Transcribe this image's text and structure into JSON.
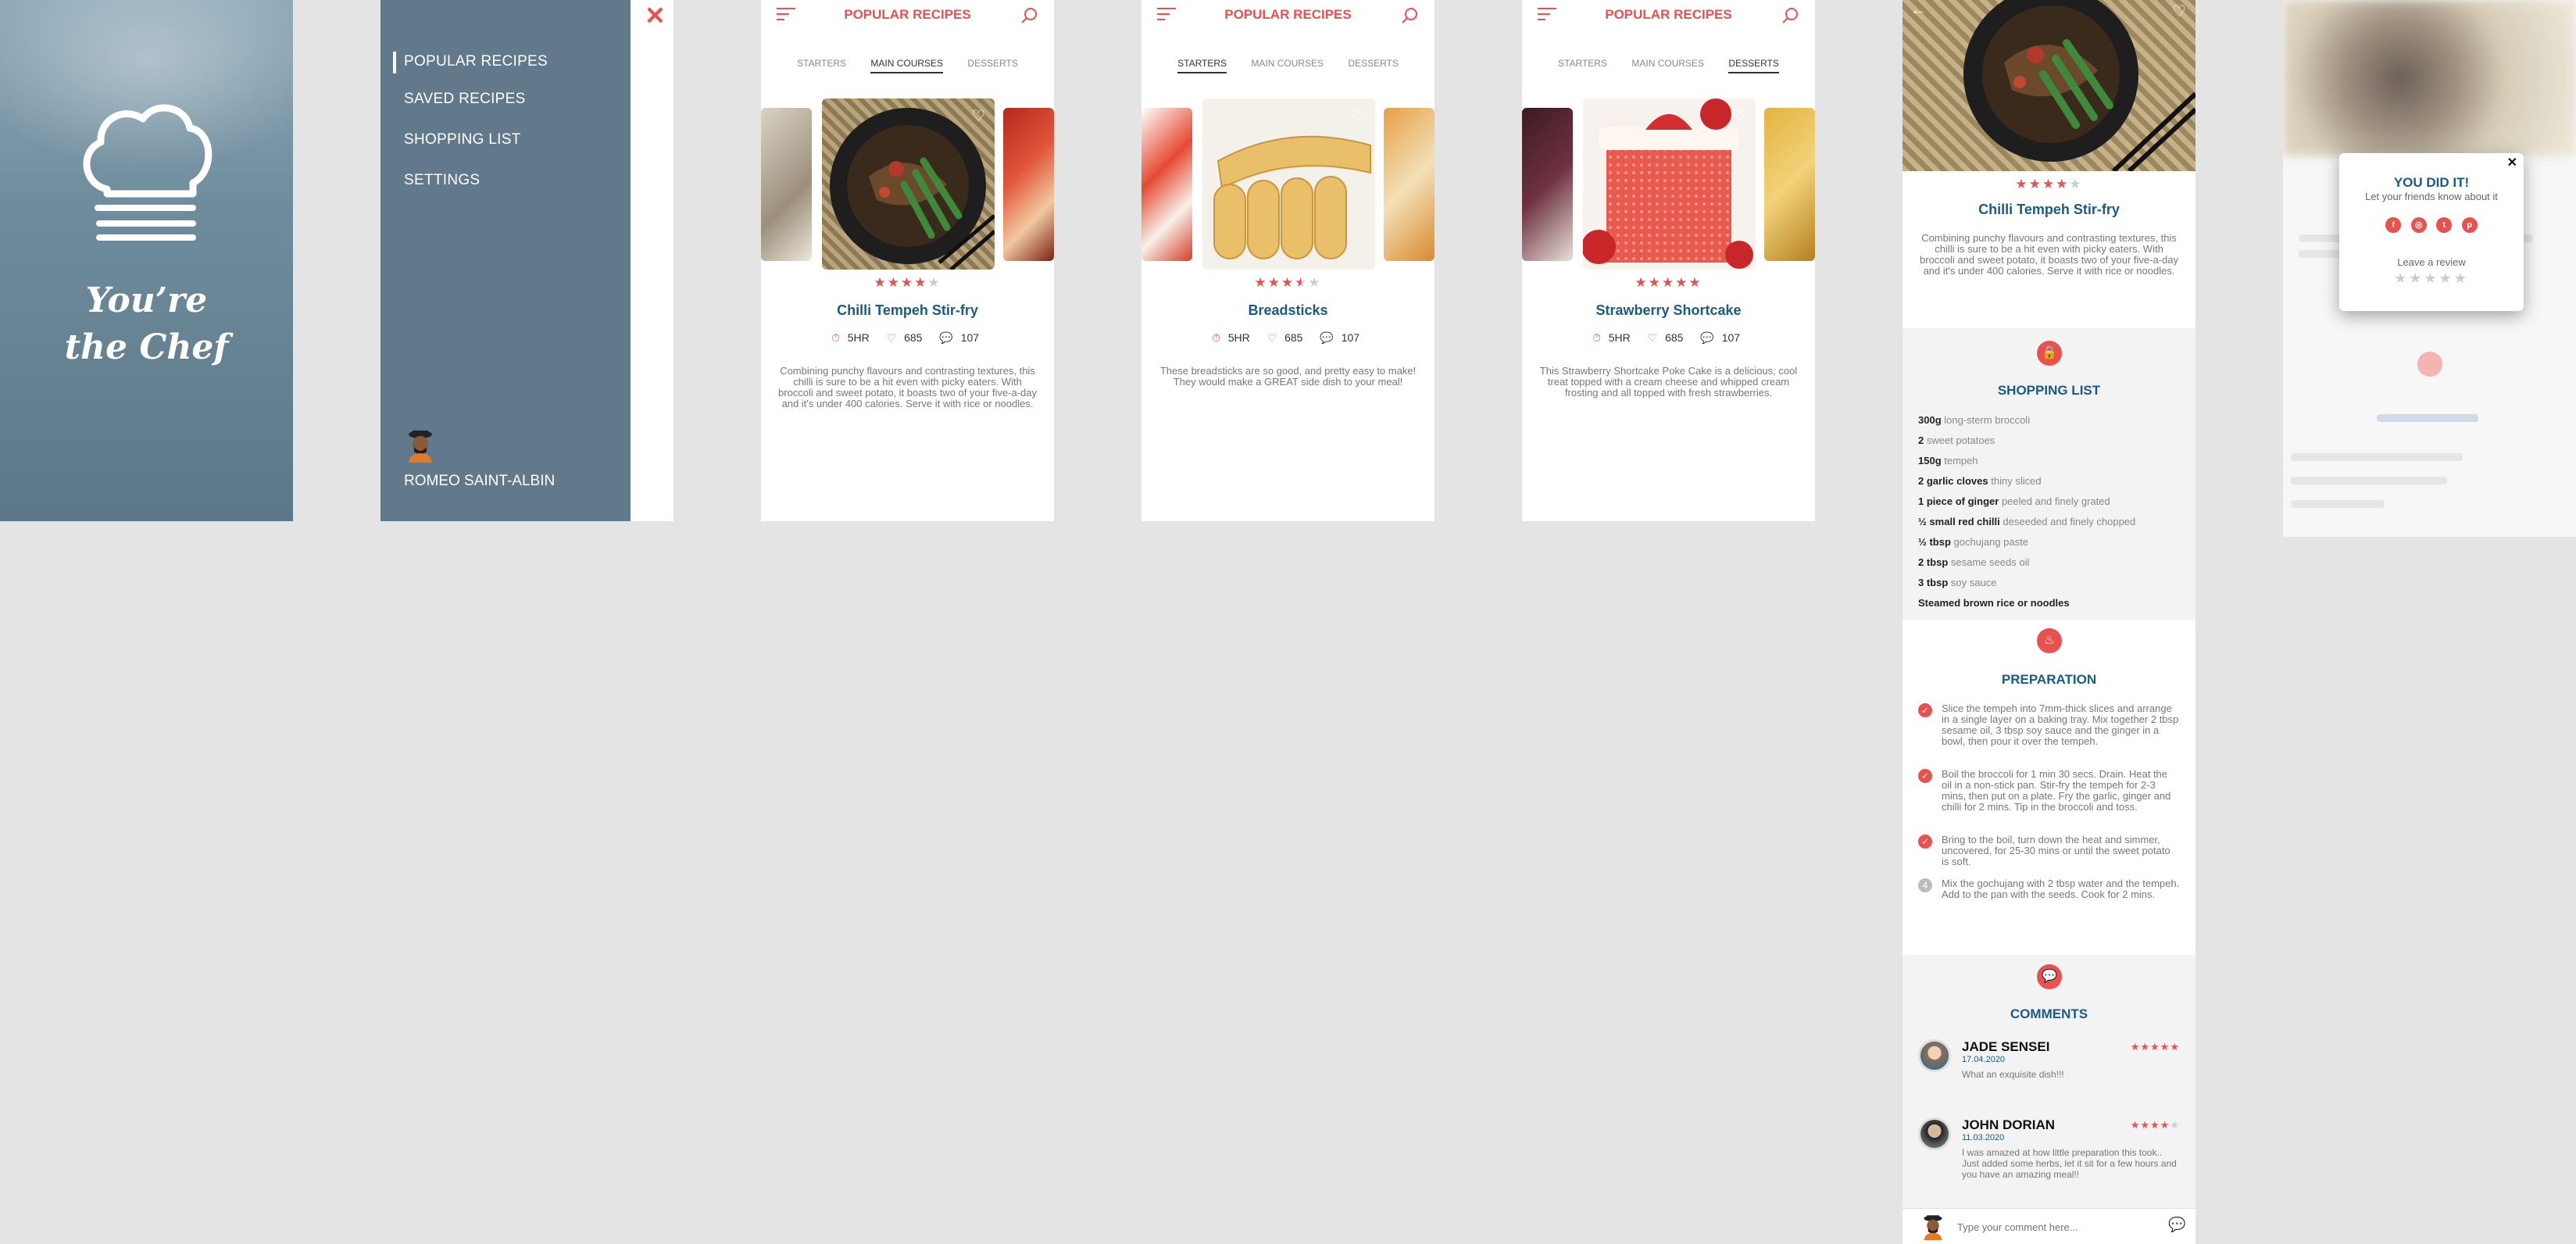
{
  "splash": {
    "tagline_line1": "You’re",
    "tagline_line2": "the Chef"
  },
  "menu": {
    "items": [
      "POPULAR RECIPES",
      "SAVED RECIPES",
      "SHOPPING LIST",
      "SETTINGS"
    ],
    "user_name": "ROMEO SAINT-ALBIN"
  },
  "screens": [
    {
      "title": "POPULAR RECIPES",
      "tabs": [
        "STARTERS",
        "MAIN COURSES",
        "DESSERTS"
      ],
      "active_tab": 1,
      "rating": 4,
      "recipe_name": "Chilli Tempeh Stir-fry",
      "time": "5HR",
      "likes": "685",
      "comments": "107",
      "description": "Combining punchy flavours and contrasting textures, this chilli is sure to be a hit even with picky eaters. With broccoli and sweet potato, it boasts two of your five-a-day and it's under 400 calories. Serve it with rice or noodles."
    },
    {
      "title": "POPULAR RECIPES",
      "tabs": [
        "STARTERS",
        "MAIN COURSES",
        "DESSERTS"
      ],
      "active_tab": 0,
      "rating": 3.5,
      "recipe_name": "Breadsticks",
      "time": "5HR",
      "likes": "685",
      "comments": "107",
      "description": "These breadsticks are so good, and pretty easy to make!  They would make a GREAT side dish to your meal!"
    },
    {
      "title": "POPULAR RECIPES",
      "tabs": [
        "STARTERS",
        "MAIN COURSES",
        "DESSERTS"
      ],
      "active_tab": 2,
      "rating": 5,
      "recipe_name": "Strawberry Shortcake",
      "time": "5HR",
      "likes": "685",
      "comments": "107",
      "description": "This Strawberry Shortcake Poke Cake is a delicious, cool treat topped with a cream cheese and whipped cream frosting and all topped with fresh strawberries."
    }
  ],
  "detail": {
    "rating": 4,
    "title": "Chilli Tempeh Stir-fry",
    "description": "Combining punchy flavours and contrasting textures, this chilli is sure to be a hit even with picky eaters. With broccoli and sweet potato, it boasts two of your five-a-day and it's under 400 calories. Serve it with rice or noodles.",
    "shopping_title": "SHOPPING LIST",
    "ingredients": [
      {
        "qty": "300g",
        "item": "long-sterm broccoli"
      },
      {
        "qty": "2",
        "item": "sweet potatoes"
      },
      {
        "qty": "150g",
        "item": "tempeh"
      },
      {
        "qty": "2 garlic cloves",
        "item": "thiny sliced"
      },
      {
        "qty": "1 piece of ginger",
        "item": "peeled and finely grated"
      },
      {
        "qty": "½ small red chilli",
        "item": "deseeded and finely chopped"
      },
      {
        "qty": "½ tbsp",
        "item": "gochujang paste"
      },
      {
        "qty": "2 tbsp",
        "item": "sesame seeds oil"
      },
      {
        "qty": "3 tbsp",
        "item": "soy sauce"
      },
      {
        "qty": "Steamed brown rice or noodles",
        "item": ""
      }
    ],
    "preparation_title": "PREPARATION",
    "steps": [
      {
        "text": "Slice the tempeh into 7mm-thick slices and arrange in a single layer on a baking tray. Mix together 2 tbsp sesame oil, 3 tbsp soy sauce and the ginger in a bowl, then pour it over the tempeh.",
        "done": true
      },
      {
        "text": "Boil the broccoli for 1 min 30 secs. Drain. Heat the oil in a non-stick pan. Stir-fry the tempeh for 2-3 mins, then put on a plate. Fry the garlic, ginger and chilli for 2 mins. Tip in the broccoli and toss.",
        "done": true
      },
      {
        "text": "Bring to the boil, turn down the heat and simmer, uncovered, for 25-30 mins or until the sweet potato is soft.",
        "done": true
      },
      {
        "text": "Mix the gochujang with 2 tbsp water and the tempeh. Add to the pan with the seeds. Cook for 2 mins.",
        "done": false,
        "num": "4"
      }
    ],
    "comments_title": "COMMENTS",
    "comments": [
      {
        "name": "JADE SENSEI",
        "date": "17.04.2020",
        "rating": 5,
        "text": "What an exquisite dish!!!"
      },
      {
        "name": "JOHN DORIAN",
        "date": "11.03.2020",
        "rating": 4,
        "text": "I was amazed at how little preparation this took.. Just added some herbs, let it sit for a few hours and you have an amazing meal!!"
      }
    ],
    "comment_placeholder": "Type your comment here..."
  },
  "popup": {
    "title": "YOU DID IT!",
    "subtitle": "Let your friends know about it",
    "social": [
      "f",
      "ig",
      "tw",
      "p"
    ],
    "leave_review": "Leave a review"
  },
  "colors": {
    "accent": "#e8514e",
    "title_blue": "#1b5a86",
    "menu_bg": "#61798a",
    "bg": "#e4e4e4"
  }
}
